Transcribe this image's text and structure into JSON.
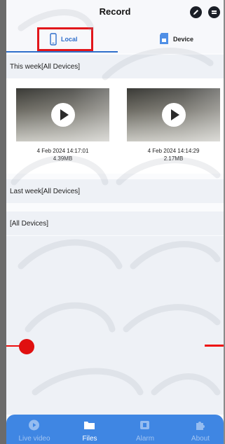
{
  "header": {
    "title": "Record"
  },
  "tabs": [
    {
      "label": "Local",
      "icon": "phone-icon",
      "active": true
    },
    {
      "label": "Device",
      "icon": "sd-card-icon",
      "active": false
    }
  ],
  "sections": {
    "this_week": {
      "title": "This week[All Devices]",
      "items": [
        {
          "date": "4 Feb 2024 14:17:01",
          "size": "4.39MB"
        },
        {
          "date": "4 Feb 2024 14:14:29",
          "size": "2.17MB"
        }
      ]
    },
    "last_week": {
      "title": "Last week[All Devices]"
    },
    "older": {
      "title": "[All Devices]"
    }
  },
  "bottom_nav": [
    {
      "label": "Live video",
      "icon": "play-circle-icon",
      "active": false
    },
    {
      "label": "Files",
      "icon": "folder-icon",
      "active": true
    },
    {
      "label": "Alarm",
      "icon": "alarm-icon",
      "active": false
    },
    {
      "label": "About",
      "icon": "puzzle-icon",
      "active": false
    }
  ],
  "colors": {
    "accent": "#2f6fcb",
    "nav": "#3f86e3",
    "highlight": "#e2161b"
  }
}
